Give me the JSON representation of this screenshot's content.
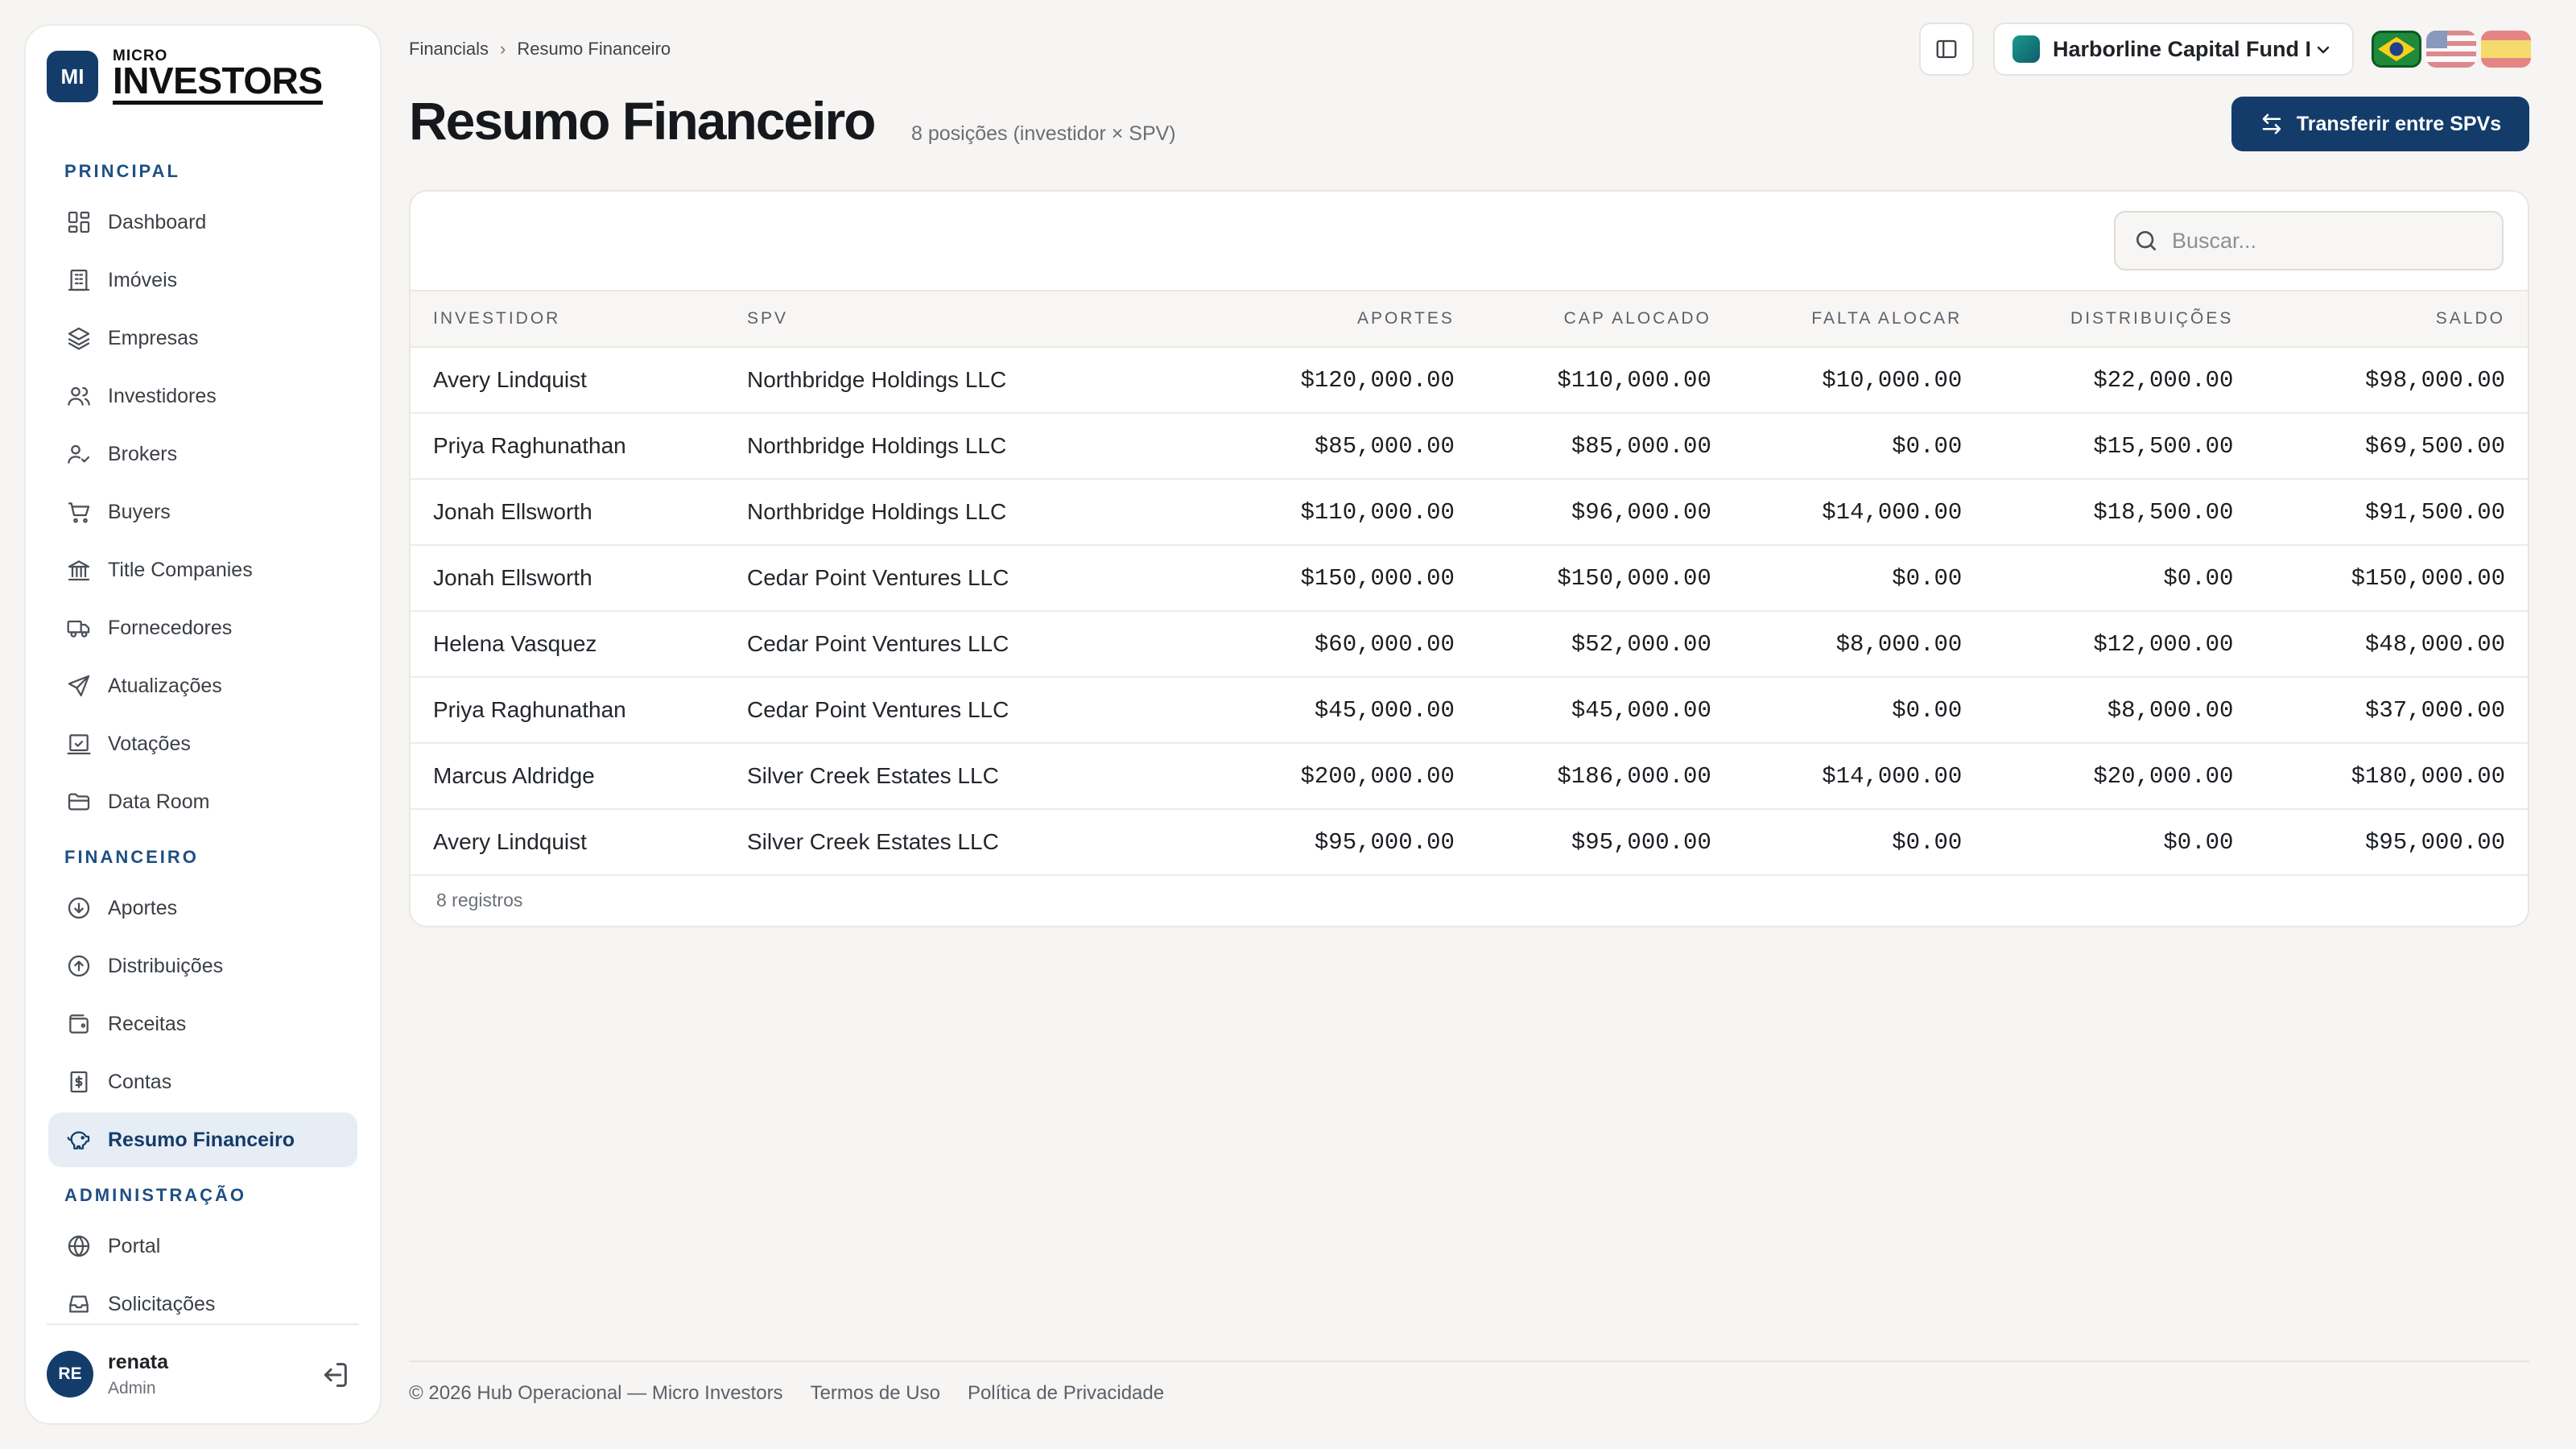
{
  "brand": {
    "badge": "MI",
    "micro": "MICRO",
    "name": "INVESTORS"
  },
  "sidebar": {
    "sections": [
      {
        "label": "PRINCIPAL",
        "items": [
          {
            "label": "Dashboard",
            "icon": "dashboard-icon"
          },
          {
            "label": "Imóveis",
            "icon": "building-icon"
          },
          {
            "label": "Empresas",
            "icon": "layers-icon"
          },
          {
            "label": "Investidores",
            "icon": "users-icon"
          },
          {
            "label": "Brokers",
            "icon": "user-check-icon"
          },
          {
            "label": "Buyers",
            "icon": "cart-icon"
          },
          {
            "label": "Title Companies",
            "icon": "landmark-icon"
          },
          {
            "label": "Fornecedores",
            "icon": "truck-icon"
          },
          {
            "label": "Atualizações",
            "icon": "send-icon"
          },
          {
            "label": "Votações",
            "icon": "vote-icon"
          },
          {
            "label": "Data Room",
            "icon": "folder-icon"
          }
        ]
      },
      {
        "label": "FINANCEIRO",
        "items": [
          {
            "label": "Aportes",
            "icon": "arrow-down-circle-icon"
          },
          {
            "label": "Distribuições",
            "icon": "arrow-up-circle-icon"
          },
          {
            "label": "Receitas",
            "icon": "wallet-icon"
          },
          {
            "label": "Contas",
            "icon": "receipt-icon"
          },
          {
            "label": "Resumo Financeiro",
            "icon": "piggy-bank-icon",
            "active": true
          }
        ]
      },
      {
        "label": "ADMINISTRAÇÃO",
        "items": [
          {
            "label": "Portal",
            "icon": "globe-icon"
          },
          {
            "label": "Solicitações",
            "icon": "inbox-icon"
          }
        ]
      }
    ],
    "user": {
      "initials": "RE",
      "name": "renata",
      "role": "Admin"
    }
  },
  "header": {
    "breadcrumb": [
      "Financials",
      "Resumo Financeiro"
    ],
    "title": "Resumo Financeiro",
    "subtitle": "8 posições (investidor × SPV)",
    "fund": "Harborline Capital Fund I",
    "transfer_label": "Transferir entre SPVs"
  },
  "table": {
    "search_placeholder": "Buscar...",
    "columns": [
      "INVESTIDOR",
      "SPV",
      "APORTES",
      "CAP ALOCADO",
      "FALTA ALOCAR",
      "DISTRIBUIÇÕES",
      "SALDO"
    ],
    "rows": [
      [
        "Avery Lindquist",
        "Northbridge Holdings LLC",
        "$120,000.00",
        "$110,000.00",
        "$10,000.00",
        "$22,000.00",
        "$98,000.00"
      ],
      [
        "Priya Raghunathan",
        "Northbridge Holdings LLC",
        "$85,000.00",
        "$85,000.00",
        "$0.00",
        "$15,500.00",
        "$69,500.00"
      ],
      [
        "Jonah Ellsworth",
        "Northbridge Holdings LLC",
        "$110,000.00",
        "$96,000.00",
        "$14,000.00",
        "$18,500.00",
        "$91,500.00"
      ],
      [
        "Jonah Ellsworth",
        "Cedar Point Ventures LLC",
        "$150,000.00",
        "$150,000.00",
        "$0.00",
        "$0.00",
        "$150,000.00"
      ],
      [
        "Helena Vasquez",
        "Cedar Point Ventures LLC",
        "$60,000.00",
        "$52,000.00",
        "$8,000.00",
        "$12,000.00",
        "$48,000.00"
      ],
      [
        "Priya Raghunathan",
        "Cedar Point Ventures LLC",
        "$45,000.00",
        "$45,000.00",
        "$0.00",
        "$8,000.00",
        "$37,000.00"
      ],
      [
        "Marcus Aldridge",
        "Silver Creek Estates LLC",
        "$200,000.00",
        "$186,000.00",
        "$14,000.00",
        "$20,000.00",
        "$180,000.00"
      ],
      [
        "Avery Lindquist",
        "Silver Creek Estates LLC",
        "$95,000.00",
        "$95,000.00",
        "$0.00",
        "$0.00",
        "$95,000.00"
      ]
    ],
    "count": "8 registros"
  },
  "footer": {
    "copyright": "© 2026 Hub Operacional — Micro Investors",
    "terms": "Termos de Uso",
    "privacy": "Política de Privacidade"
  },
  "colors": {
    "primary": "#143c6b",
    "accent_label": "#1e4f84",
    "active_bg": "#e7edf5"
  }
}
